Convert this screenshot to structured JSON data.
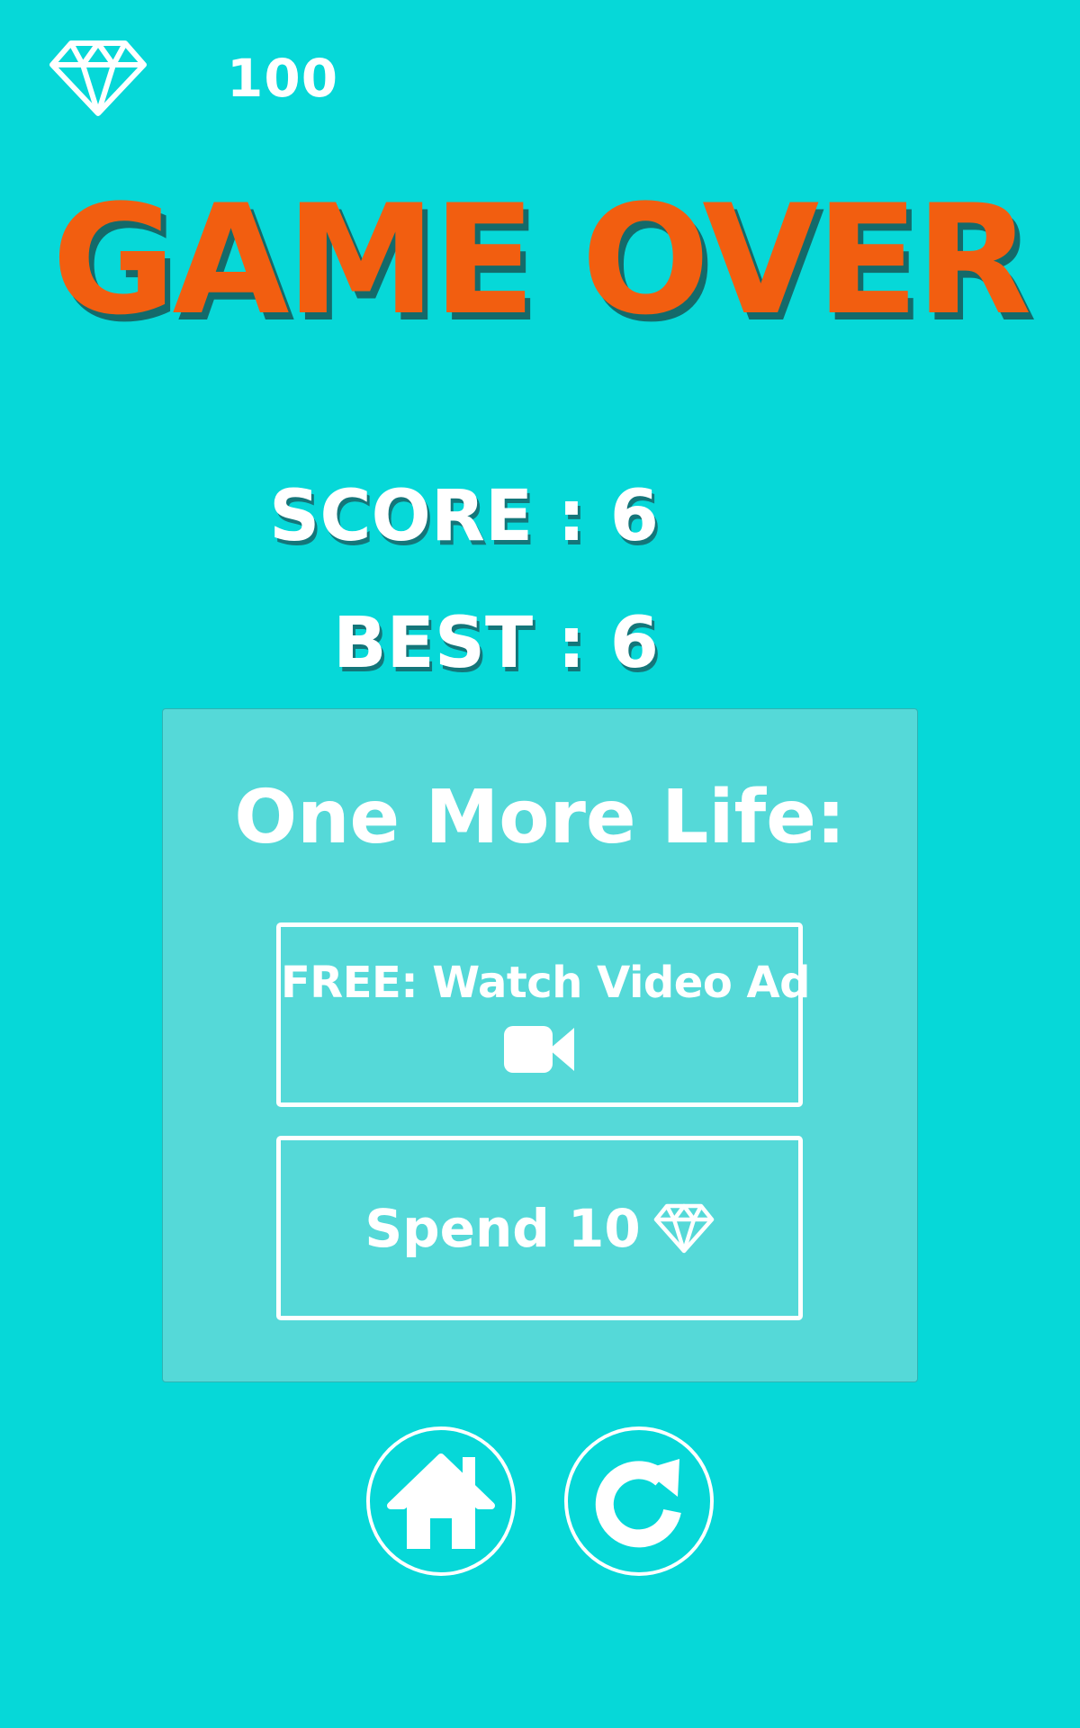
{
  "colors": {
    "background": "#06d8d8",
    "panel": "#55d9d8",
    "title": "#f25e10",
    "text": "#ffffff",
    "shadow": "#146a6a"
  },
  "header": {
    "gem_icon": "diamond-icon",
    "gem_count": "100"
  },
  "title": "GAME OVER",
  "stats": {
    "score": "SCORE : 6",
    "best": "BEST : 6"
  },
  "revive_panel": {
    "title": "One More Life:",
    "watch_ad_label": "FREE: Watch Video Ad",
    "watch_ad_icon": "video-camera-icon",
    "spend_label": "Spend 10",
    "spend_icon": "diamond-icon"
  },
  "footer": {
    "home_icon": "home-icon",
    "replay_icon": "replay-icon"
  }
}
